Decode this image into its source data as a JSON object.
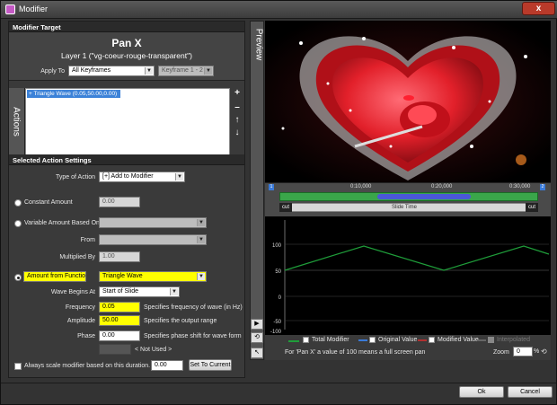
{
  "window": {
    "title": "Modifier",
    "close_label": "x"
  },
  "modifier_target": {
    "header": "Modifier Target",
    "name": "Pan X",
    "layer": "Layer 1 (\"vg-coeur-rouge-transparent\")",
    "apply_to_label": "Apply To",
    "apply_to_value": "All Keyframes",
    "keyframe_range": "Keyframe 1 - 2"
  },
  "actions": {
    "side_label": "Actions",
    "items": [
      {
        "label": "+ Triangle Wave (0.05,50.00,0.00)"
      }
    ],
    "buttons": {
      "add": "+",
      "remove": "–",
      "up": "↑",
      "down": "↓"
    }
  },
  "settings": {
    "header": "Selected Action Settings",
    "type_label": "Type of Action",
    "type_value": "[+] Add to Modifier",
    "constant_label": "Constant Amount",
    "constant_value": "0.00",
    "variable_label": "Variable Amount Based On",
    "from_label": "From",
    "multiplied_label": "Multiplied By",
    "multiplied_value": "1.00",
    "function_label": "Amount from Function",
    "function_value": "Triangle Wave",
    "wave_begins_label": "Wave Begins At",
    "wave_begins_value": "Start of Slide",
    "frequency_label": "Frequency",
    "frequency_value": "0.05",
    "frequency_desc": "Specifies frequency of wave (in Hz)",
    "amplitude_label": "Amplitude",
    "amplitude_value": "50.00",
    "amplitude_desc": "Specifies the output range",
    "phase_label": "Phase",
    "phase_value": "0.00",
    "phase_desc": "Specifies phase shift for wave form",
    "not_used": "< Not Used >",
    "always_scale_label": "Always scale modifier based on this duration.",
    "duration_value": "0.00",
    "set_current_label": "Set To Current"
  },
  "preview": {
    "side_label": "Preview"
  },
  "timeline": {
    "markers": [
      "0:10,000",
      "0:20,000",
      "0:30,000"
    ],
    "start_badge": "1",
    "end_badge": "2",
    "cut_left": "cut",
    "cut_right": "cut",
    "slide_time": "Slide Time"
  },
  "graph": {
    "y_ticks": [
      "100",
      "50",
      "0",
      "-50",
      "-100"
    ]
  },
  "legend": {
    "total": "Total Modifier",
    "original": "Original Value",
    "modified": "Modified Value",
    "interpolated": "Interpolated",
    "note": "For 'Pan X' a value of 100 means a full screen pan",
    "zoom_label": "Zoom",
    "zoom_value": "0",
    "zoom_unit": "%"
  },
  "footer": {
    "ok": "Ok",
    "cancel": "Cancel"
  },
  "colors": {
    "accent_yellow": "#ffff00",
    "selection_blue": "#3c82d8",
    "wave_green": "#1f9e3a"
  }
}
